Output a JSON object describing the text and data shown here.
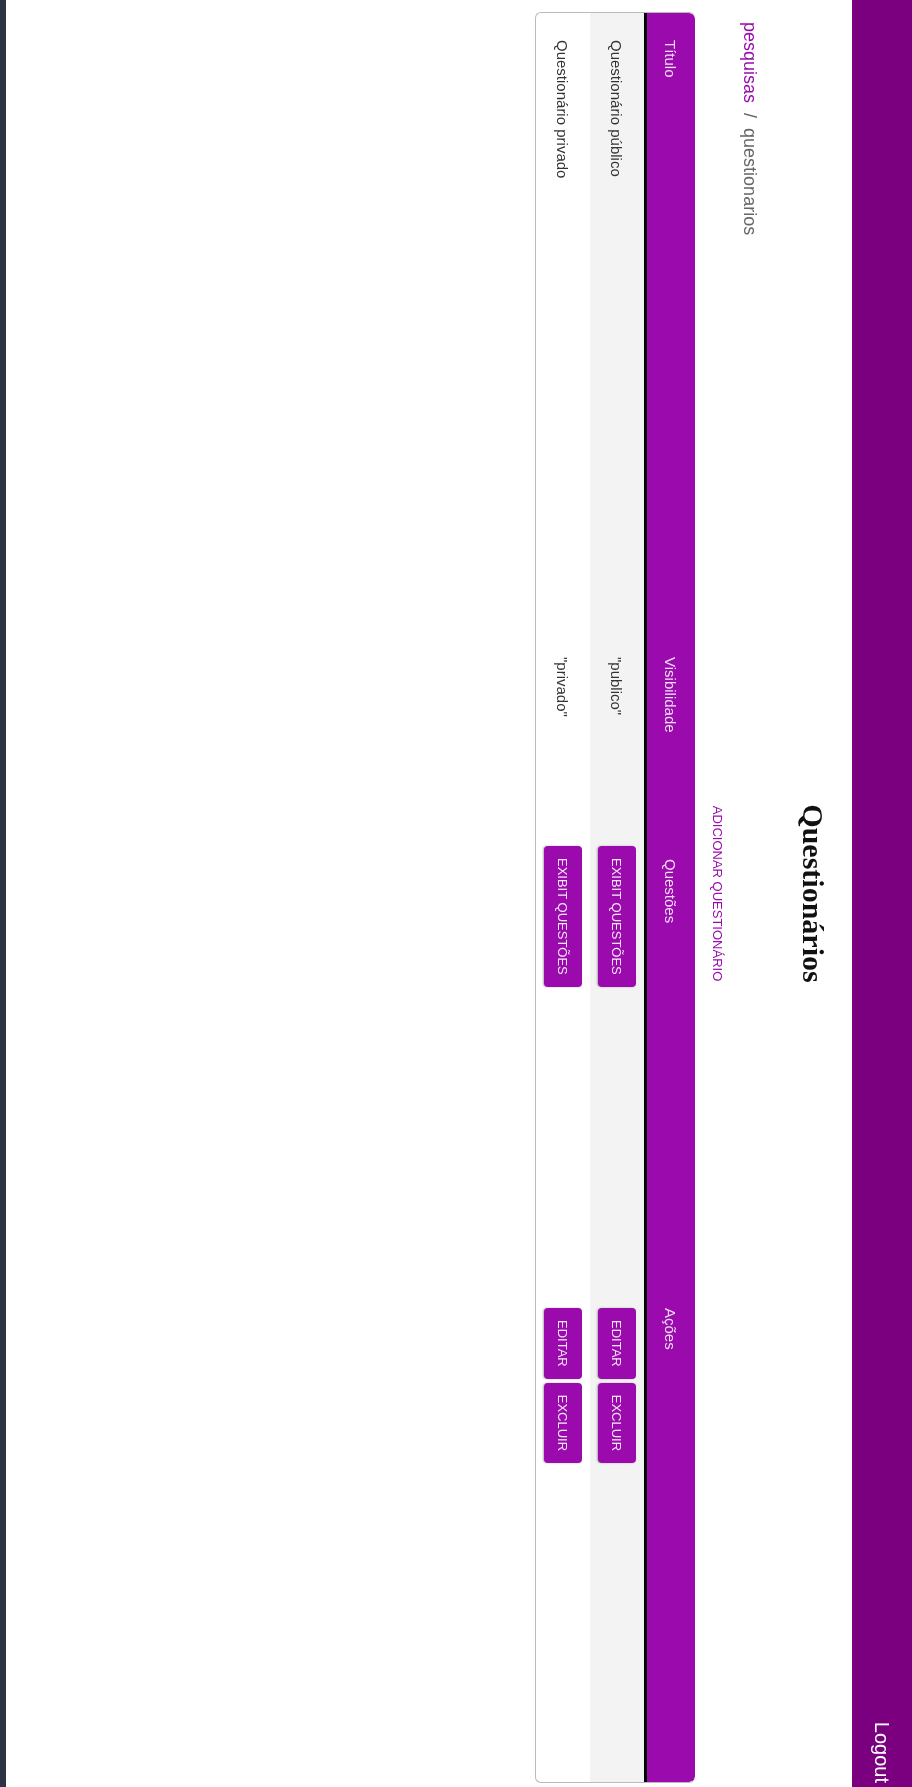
{
  "navbar": {
    "logout": "Logout"
  },
  "title": "Questionários",
  "breadcrumb": [
    {
      "label": "pesquisas",
      "kind": "link"
    },
    {
      "label": "/",
      "kind": "separator"
    },
    {
      "label": "questionarios",
      "kind": "current"
    }
  ],
  "add_link": "ADICIONAR QUESTIONÁRIO",
  "table": {
    "columns": [
      "Título",
      "Visibilidade",
      "Questões",
      "Ações"
    ],
    "rows": [
      {
        "title": "Questionário público",
        "visibility": "\"publico\"",
        "questions_button": "EXIBIT QUESTÕES",
        "actions": [
          "EDITAR",
          "EXCLUIR"
        ]
      },
      {
        "title": "Questionário privado",
        "visibility": "\"privado\"",
        "questions_button": "EXIBIT QUESTÕES",
        "actions": [
          "EDITAR",
          "EXCLUIR"
        ]
      }
    ]
  }
}
